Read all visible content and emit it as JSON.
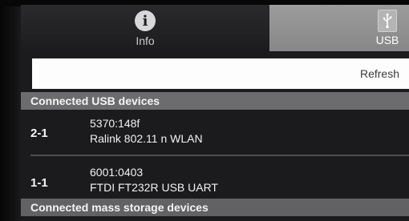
{
  "tabs": [
    {
      "label": "Info",
      "icon": "info-icon",
      "selected": false
    },
    {
      "label": "USB",
      "icon": "usb-icon",
      "selected": true
    }
  ],
  "toolbar": {
    "refresh_label": "Refresh"
  },
  "sections": {
    "usb_devices_title": "Connected USB devices",
    "mass_storage_title": "Connected mass storage devices"
  },
  "usb_devices": [
    {
      "id": "2-1",
      "vid_pid": "5370:148f",
      "name": "Ralink 802.11 n WLAN"
    },
    {
      "id": "1-1",
      "vid_pid": "6001:0403",
      "name": "FTDI FT232R USB UART"
    }
  ],
  "colors": {
    "tab_selected_bg": "#8f8f8f",
    "section_header_bg": "#6c6c6e",
    "screen_bg": "#1b1b1d"
  }
}
